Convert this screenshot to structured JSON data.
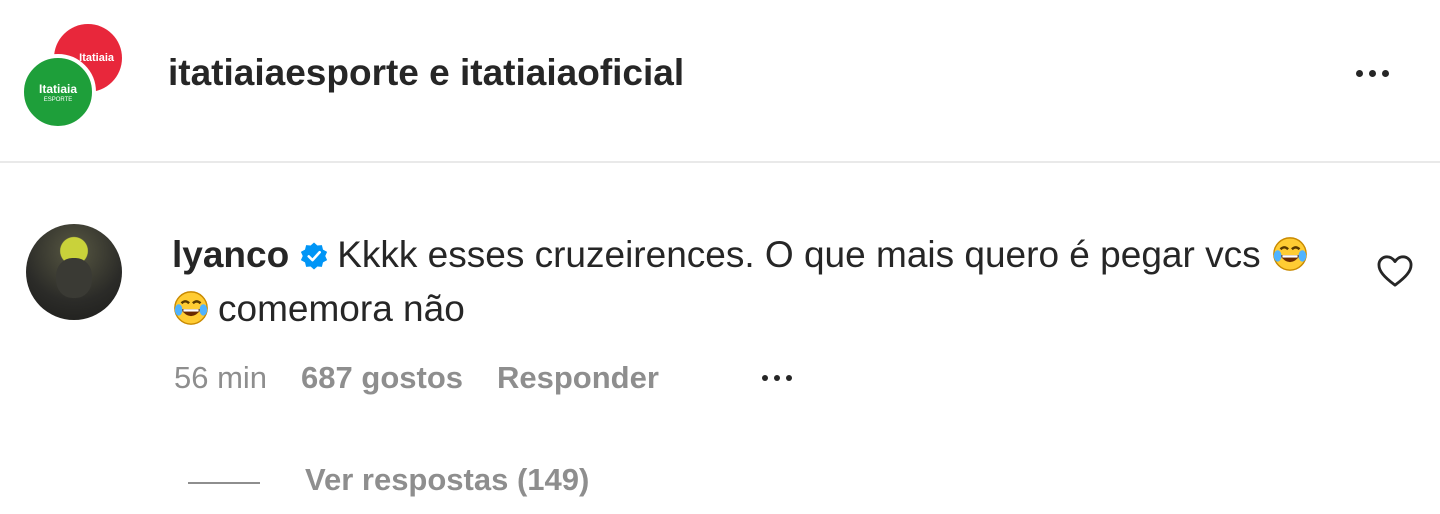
{
  "header": {
    "title": "itatiaiaesporte e itatiaiaoficial",
    "avatar_red_text": "Itatiaia",
    "avatar_green_text": "Itatiaia",
    "avatar_green_subtext": "ESPORTE",
    "more_icon": "more-horizontal-icon"
  },
  "comment": {
    "username": "lyanco",
    "verified_icon": "verified-badge-icon",
    "text_part1": "Kkkk esses cruzeirences. O que mais quero é pegar vcs",
    "emoji": "😂",
    "emoji_count": 2,
    "text_part2": "comemora não",
    "time": "56 min",
    "likes": "687 gostos",
    "reply_label": "Responder",
    "like_icon": "heart-outline-icon"
  },
  "replies": {
    "label": "Ver respostas (149)"
  },
  "colors": {
    "text": "#262626",
    "secondary": "#8e8e8e",
    "verified": "#0095f6",
    "avatar_red": "#e8273b",
    "avatar_green": "#1e9f3a"
  }
}
